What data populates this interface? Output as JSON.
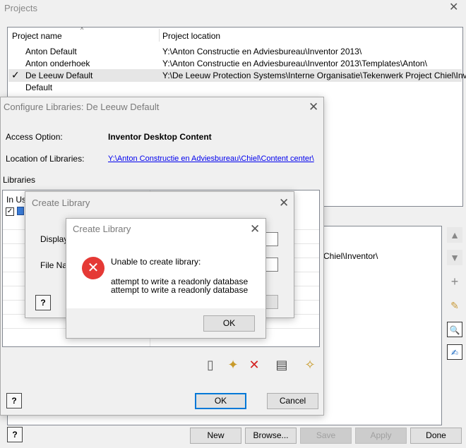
{
  "main": {
    "title": "Projects",
    "columns": [
      "Project name",
      "Project location"
    ],
    "projects": [
      {
        "name": "Anton Default",
        "location": "Y:\\Anton Constructie en Adviesbureau\\Inventor 2013\\",
        "active": false
      },
      {
        "name": "Anton onderhoek",
        "location": "Y:\\Anton Constructie en Adviesbureau\\Inventor 2013\\Templates\\Anton\\",
        "active": false
      },
      {
        "name": "De Leeuw Default",
        "location": "Y:\\De Leeuw Protection Systems\\Interne Organisatie\\Tekenwerk Project Chiel\\Inve...",
        "active": true
      },
      {
        "name": "Default",
        "location": "",
        "active": false
      }
    ],
    "active_marker": "✓",
    "detail_fragment": "Chiel\\Inventor\\",
    "buttons": {
      "new": "New",
      "browse": "Browse...",
      "save": "Save",
      "apply": "Apply",
      "done": "Done"
    },
    "help": "?"
  },
  "configure": {
    "title": "Configure Libraries: De Leeuw Default",
    "access_label": "Access Option:",
    "access_value": "Inventor Desktop Content",
    "location_label": "Location of Libraries:",
    "location_value": "Y:\\Anton Constructie en Adviesbureau\\Chiel\\Content center\\",
    "libraries_label": "Libraries",
    "in_use_label": "In Use",
    "ok": "OK",
    "cancel": "Cancel",
    "help": "?"
  },
  "create_back": {
    "title": "Create Library",
    "display_label": "Display Name:",
    "file_label": "File Name:",
    "help": "?"
  },
  "create_error": {
    "title": "Create Library",
    "message": "Unable to create library:",
    "detail_1": "attempt to write a readonly database",
    "detail_2": "attempt to write a readonly database",
    "ok": "OK"
  }
}
